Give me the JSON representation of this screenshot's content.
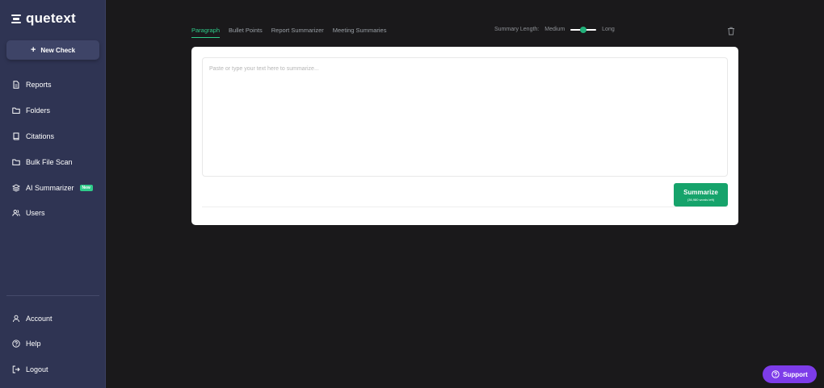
{
  "brand": {
    "name": "quetext"
  },
  "sidebar": {
    "new_check": "New Check",
    "items": [
      {
        "label": "Reports",
        "icon": "file-icon"
      },
      {
        "label": "Folders",
        "icon": "folder-icon"
      },
      {
        "label": "Citations",
        "icon": "book-icon"
      },
      {
        "label": "Bulk File Scan",
        "icon": "folder-icon"
      },
      {
        "label": "AI Summarizer",
        "icon": "layers-icon",
        "badge": "New"
      },
      {
        "label": "Users",
        "icon": "users-icon"
      }
    ],
    "bottom": [
      {
        "label": "Account",
        "icon": "user-icon"
      },
      {
        "label": "Help",
        "icon": "help-icon"
      },
      {
        "label": "Logout",
        "icon": "logout-icon"
      }
    ]
  },
  "tabs": [
    {
      "label": "Paragraph",
      "active": true
    },
    {
      "label": "Bullet Points",
      "active": false
    },
    {
      "label": "Report Summarizer",
      "active": false
    },
    {
      "label": "Meeting Summaries",
      "active": false
    }
  ],
  "summary_length": {
    "label": "Summary Length:",
    "min_label": "Medium",
    "max_label": "Long",
    "value_fraction": 0.5
  },
  "editor": {
    "placeholder": "Paste or type your text here to summarize...",
    "button_label": "Summarize",
    "words_left": "(36,980 words left)"
  },
  "support": {
    "label": "Support"
  },
  "colors": {
    "sidebar": "#2f3453",
    "accent": "#2fcc8a",
    "button": "#16a36b",
    "support": "#7d3ce9",
    "background": "#1a191b"
  }
}
